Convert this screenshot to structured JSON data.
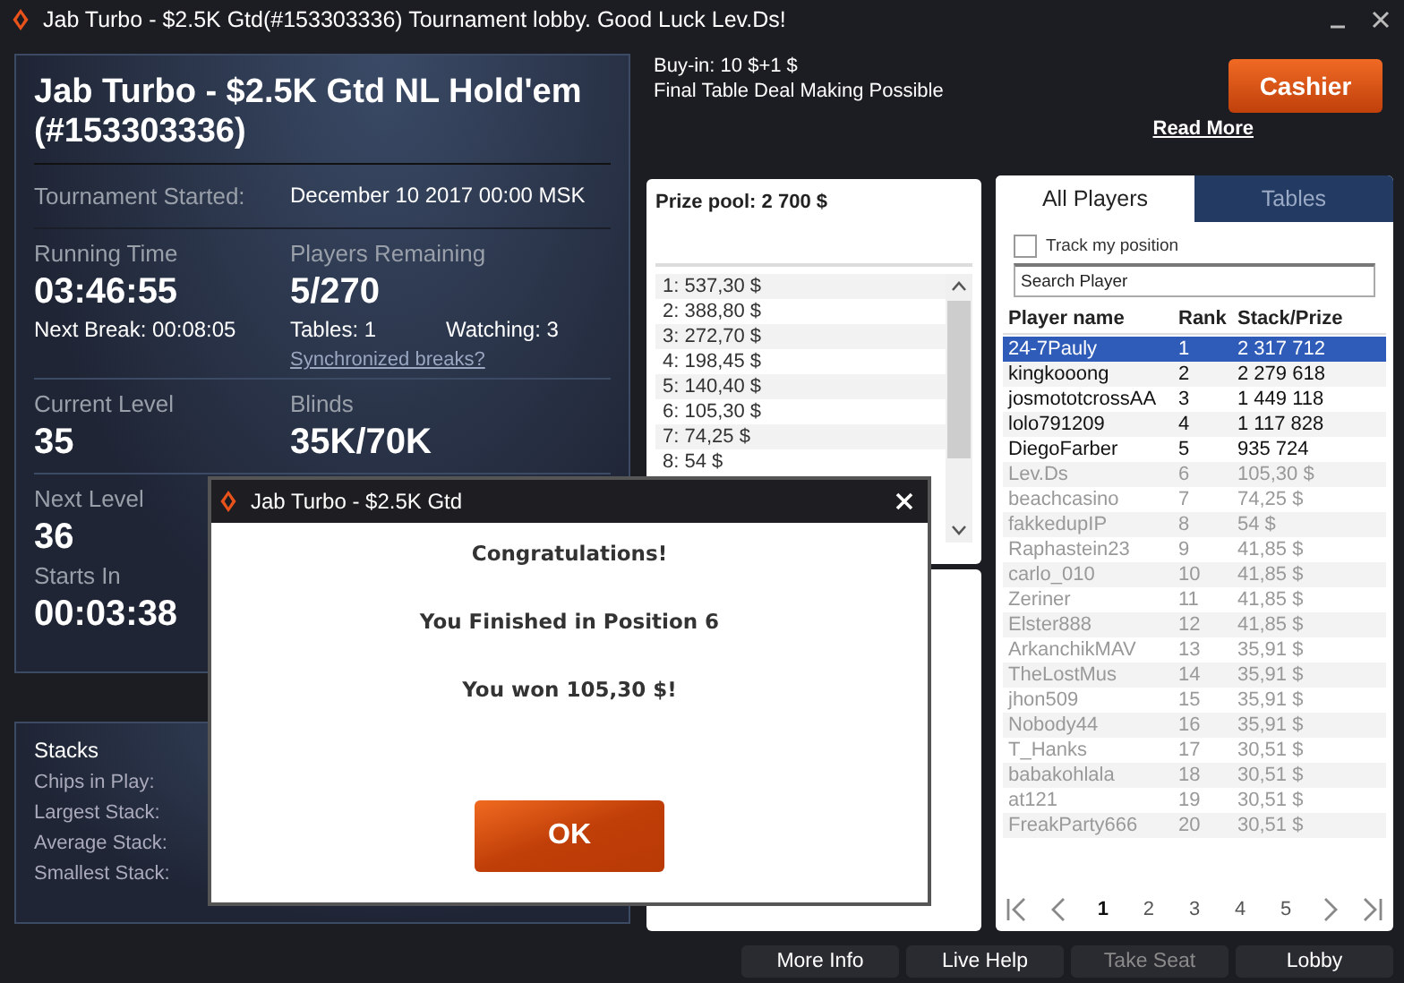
{
  "window": {
    "title": "Jab Turbo - $2.5K Gtd(#153303336) Tournament lobby. Good Luck Lev.Ds!"
  },
  "tournament": {
    "title": "Jab Turbo - $2.5K Gtd NL Hold'em (#153303336)",
    "started_label": "Tournament Started:",
    "started_value": "December 10 2017  00:00 MSK",
    "running_label": "Running Time",
    "running_value": "03:46:55",
    "next_break": "Next Break: 00:08:05",
    "players_label": "Players Remaining",
    "players_value": "5/270",
    "tables": "Tables: 1",
    "watching": "Watching: 3",
    "sync_link": "Synchronized breaks?",
    "level_label": "Current Level",
    "level_value": "35",
    "blinds_label": "Blinds",
    "blinds_value": "35K/70K",
    "next_level_label": "Next Level",
    "next_level_value": "36",
    "starts_label": "Starts In",
    "starts_value": "00:03:38"
  },
  "stacks": {
    "title": "Stacks",
    "labels": [
      "Chips in Play:",
      "Largest Stack:",
      "Average Stack:",
      "Smallest Stack:"
    ]
  },
  "info": {
    "buy_in": "Buy-in: 10 $+1 $",
    "deal": "Final Table Deal Making Possible",
    "read_more": "Read More",
    "cashier": "Cashier"
  },
  "prize_pool": {
    "title": "Prize pool: 2 700 $",
    "places": [
      "1: 537,30 $",
      "2: 388,80 $",
      "3: 272,70 $",
      "4: 198,45 $",
      "5: 140,40 $",
      "6: 105,30 $",
      "7: 74,25 $",
      "8: 54 $"
    ]
  },
  "players_panel": {
    "tabs": [
      {
        "label": "All Players",
        "selected": true
      },
      {
        "label": "Tables",
        "selected": false
      }
    ],
    "track": {
      "label": "Track my position",
      "checked": false
    },
    "search": {
      "value": "Search Player"
    },
    "columns": [
      "Player name",
      "Rank",
      "Stack/Prize"
    ],
    "rows": [
      {
        "name": "24-7Pauly",
        "rank": "1",
        "stack": "2 317 712",
        "selected": true,
        "eliminated": false
      },
      {
        "name": "kingkooong",
        "rank": "2",
        "stack": "2 279 618",
        "selected": false,
        "eliminated": false
      },
      {
        "name": "josmototcrossAA",
        "rank": "3",
        "stack": "1 449 118",
        "selected": false,
        "eliminated": false
      },
      {
        "name": "lolo791209",
        "rank": "4",
        "stack": "1 117 828",
        "selected": false,
        "eliminated": false
      },
      {
        "name": "DiegoFarber",
        "rank": "5",
        "stack": "935 724",
        "selected": false,
        "eliminated": false
      },
      {
        "name": "Lev.Ds",
        "rank": "6",
        "stack": "105,30 $",
        "selected": false,
        "eliminated": true
      },
      {
        "name": "beachcasino",
        "rank": "7",
        "stack": "74,25 $",
        "selected": false,
        "eliminated": true
      },
      {
        "name": "fakkedupIP",
        "rank": "8",
        "stack": "54 $",
        "selected": false,
        "eliminated": true
      },
      {
        "name": "Raphastein23",
        "rank": "9",
        "stack": "41,85 $",
        "selected": false,
        "eliminated": true
      },
      {
        "name": "carlo_010",
        "rank": "10",
        "stack": "41,85 $",
        "selected": false,
        "eliminated": true
      },
      {
        "name": "Zeriner",
        "rank": "11",
        "stack": "41,85 $",
        "selected": false,
        "eliminated": true
      },
      {
        "name": "Elster888",
        "rank": "12",
        "stack": "41,85 $",
        "selected": false,
        "eliminated": true
      },
      {
        "name": "ArkanchikMAV",
        "rank": "13",
        "stack": "35,91 $",
        "selected": false,
        "eliminated": true
      },
      {
        "name": "TheLostMus",
        "rank": "14",
        "stack": "35,91 $",
        "selected": false,
        "eliminated": true
      },
      {
        "name": "jhon509",
        "rank": "15",
        "stack": "35,91 $",
        "selected": false,
        "eliminated": true
      },
      {
        "name": "Nobody44",
        "rank": "16",
        "stack": "35,91 $",
        "selected": false,
        "eliminated": true
      },
      {
        "name": "T_Hanks",
        "rank": "17",
        "stack": "30,51 $",
        "selected": false,
        "eliminated": true
      },
      {
        "name": "babakohlala",
        "rank": "18",
        "stack": "30,51 $",
        "selected": false,
        "eliminated": true
      },
      {
        "name": "at121",
        "rank": "19",
        "stack": "30,51 $",
        "selected": false,
        "eliminated": true
      },
      {
        "name": "FreakParty666",
        "rank": "20",
        "stack": "30,51 $",
        "selected": false,
        "eliminated": true
      }
    ],
    "pages": [
      {
        "label": "1",
        "selected": true
      },
      {
        "label": "2",
        "selected": false
      },
      {
        "label": "3",
        "selected": false
      },
      {
        "label": "4",
        "selected": false
      },
      {
        "label": "5",
        "selected": false
      }
    ]
  },
  "bottom_buttons": [
    {
      "label": "More Info",
      "disabled": false
    },
    {
      "label": "Live Help",
      "disabled": false
    },
    {
      "label": "Take Seat",
      "disabled": true
    },
    {
      "label": "Lobby",
      "disabled": false
    }
  ],
  "dialog": {
    "title": "Jab Turbo - $2.5K Gtd",
    "lines": [
      "Congratulations!",
      "You Finished in Position 6",
      "You won 105,30 $!"
    ],
    "button": "OK"
  }
}
